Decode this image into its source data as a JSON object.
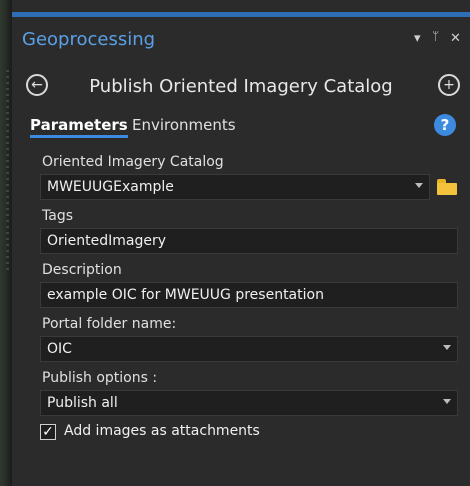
{
  "pane": {
    "title": "Geoprocessing",
    "controls": {
      "menu": "▾",
      "pin": "ᵖ",
      "close": "✕"
    }
  },
  "tool": {
    "title": "Publish Oriented Imagery Catalog",
    "back_glyph": "←",
    "add_glyph": "+"
  },
  "tabs": {
    "active": "Parameters",
    "other": "Environments",
    "help_glyph": "?"
  },
  "params": {
    "catalog": {
      "label": "Oriented Imagery Catalog",
      "value": "MWEUUGExample"
    },
    "tags": {
      "label": "Tags",
      "value": "OrientedImagery"
    },
    "description": {
      "label": "Description",
      "value": "example OIC for MWEUUG presentation"
    },
    "portal_folder": {
      "label": "Portal folder name:",
      "value": "OIC"
    },
    "publish_options": {
      "label": "Publish options :",
      "value": "Publish all"
    },
    "attachments": {
      "label": "Add images as attachments",
      "checked": true,
      "check_glyph": "✓"
    }
  },
  "colors": {
    "accent": "#3d8be0",
    "title_blue": "#5aa0e6",
    "folder": "#f2c33b"
  }
}
